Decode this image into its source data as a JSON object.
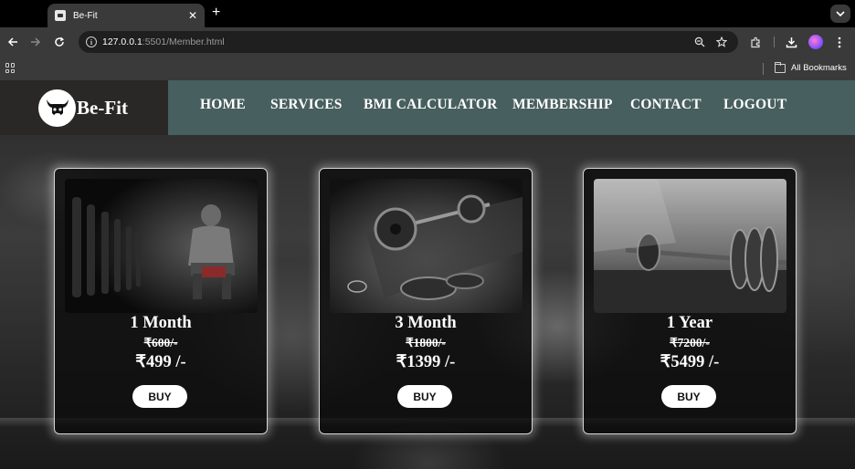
{
  "browser": {
    "tab_title": "Be-Fit",
    "url_host": "127.0.0.1",
    "url_path": ":5501/Member.html",
    "bookmarks_label": "All Bookmarks"
  },
  "site": {
    "logo_text": "Be-Fit",
    "nav": [
      {
        "label": "HOME"
      },
      {
        "label": "SERVICES"
      },
      {
        "label": "BMI CALCULATOR"
      },
      {
        "label": "MEMBERSHIP"
      },
      {
        "label": "CONTACT"
      },
      {
        "label": "LOGOUT"
      }
    ],
    "plans": [
      {
        "title": "1 Month",
        "old_price": "₹600/-",
        "price": "₹499 /-",
        "button": "BUY"
      },
      {
        "title": "3 Month",
        "old_price": "₹1800/-",
        "price": "₹1399 /-",
        "button": "BUY"
      },
      {
        "title": "1 Year",
        "old_price": "₹7200/-",
        "price": "₹5499 /-",
        "button": "BUY"
      }
    ]
  },
  "colors": {
    "nav_bg": "#475f5e",
    "logo_bg": "#2a2826",
    "chrome_bg": "#3a3a3a"
  }
}
